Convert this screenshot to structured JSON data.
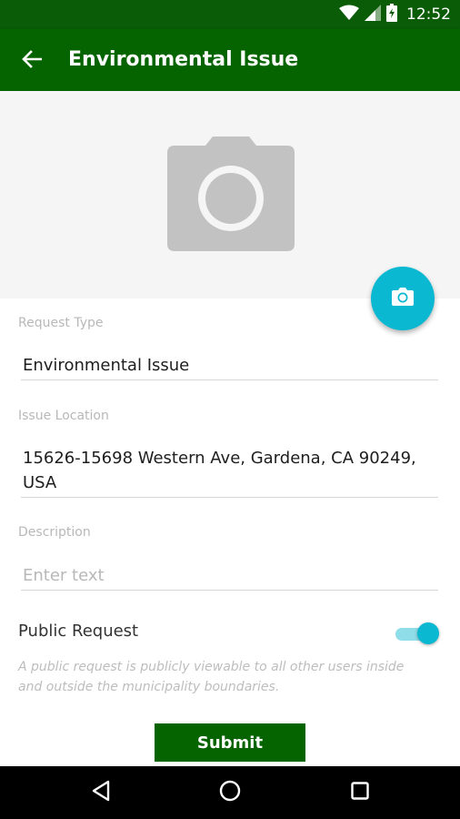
{
  "status_bar": {
    "time": "12:52",
    "icons": [
      "wifi-icon",
      "signal-icon",
      "battery-icon"
    ]
  },
  "app_bar": {
    "title": "Environmental Issue",
    "back_icon": "arrow-left-icon"
  },
  "photo": {
    "placeholder_icon": "camera-icon",
    "fab_icon": "camera-icon"
  },
  "form": {
    "request_type": {
      "label": "Request Type",
      "value": "Environmental Issue"
    },
    "issue_location": {
      "label": "Issue Location",
      "value_line1": "15626-15698 Western Ave, Gardena, CA 90249,",
      "value_line2": "USA"
    },
    "description": {
      "label": "Description",
      "placeholder": "Enter text",
      "value": ""
    },
    "public_request": {
      "label": "Public Request",
      "enabled": true,
      "helper_line1": "A public request is publicly viewable to all other users inside",
      "helper_line2": "and outside the municipality boundaries."
    },
    "submit_label": "Submit"
  },
  "nav_bar": {
    "icons": [
      "back-triangle-icon",
      "home-circle-icon",
      "recents-square-icon"
    ]
  },
  "colors": {
    "primary": "#066400",
    "status_bar": "#0a5c07",
    "accent": "#0ab8d2"
  }
}
